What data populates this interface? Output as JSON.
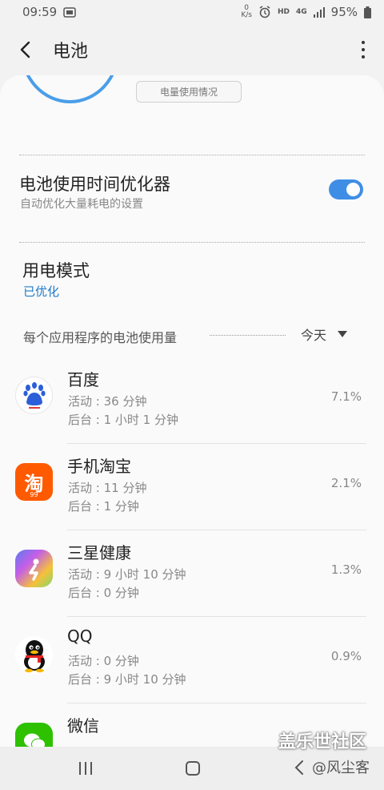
{
  "status_bar": {
    "time": "09:59",
    "net_speed_top": "0",
    "net_speed_bottom": "K/s",
    "hd_label": "HD",
    "network_label": "4G",
    "battery_pct": "95%"
  },
  "header": {
    "title": "电池"
  },
  "card": {
    "usage_button": "电量使用情况",
    "optimizer": {
      "title": "电池使用时间优化器",
      "subtitle": "自动优化大量耗电的设置",
      "enabled": true
    },
    "power_mode": {
      "title": "用电模式",
      "value": "已优化"
    },
    "usage_section": {
      "label": "每个应用程序的电池使用量",
      "period": "今天"
    }
  },
  "apps": [
    {
      "name": "百度",
      "active": "活动 : 36 分钟",
      "background": "后台 : 1 小时 1 分钟",
      "percent": "7.1%",
      "icon": "baidu-icon",
      "color": "#2b5fd9"
    },
    {
      "name": "手机淘宝",
      "active": "活动 : 11 分钟",
      "background": "后台 : 1 分钟",
      "percent": "2.1%",
      "icon": "taobao-icon",
      "color": "#ff5a00"
    },
    {
      "name": "三星健康",
      "active": "活动 : 9 小时 10 分钟",
      "background": "后台 : 0 分钟",
      "percent": "1.3%",
      "icon": "samsung-health-icon",
      "color": "#5b7cf0"
    },
    {
      "name": "QQ",
      "active": "活动 : 0 分钟",
      "background": "后台 : 9 小时 10 分钟",
      "percent": "0.9%",
      "icon": "qq-icon",
      "color": "#111111"
    },
    {
      "name": "微信",
      "active": "",
      "background": "",
      "percent": "",
      "icon": "wechat-icon",
      "color": "#2dc100"
    }
  ],
  "icon_glyphs": {
    "taobao": "淘",
    "taobao_badge": "99",
    "baidu": "du"
  },
  "watermark": {
    "main": "盖乐世社区",
    "sub": "@风尘客"
  }
}
